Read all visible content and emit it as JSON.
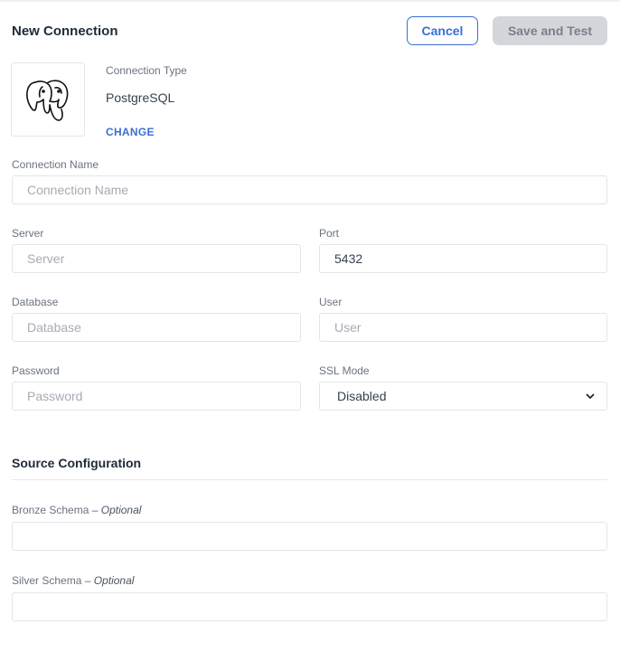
{
  "header": {
    "title": "New Connection",
    "cancel_label": "Cancel",
    "save_label": "Save and Test"
  },
  "connection_type": {
    "label": "Connection Type",
    "value": "PostgreSQL",
    "change_label": "CHANGE",
    "icon": "postgresql-elephant-icon"
  },
  "fields": {
    "connection_name": {
      "label": "Connection Name",
      "placeholder": "Connection Name",
      "value": ""
    },
    "server": {
      "label": "Server",
      "placeholder": "Server",
      "value": ""
    },
    "port": {
      "label": "Port",
      "placeholder": "",
      "value": "5432"
    },
    "database": {
      "label": "Database",
      "placeholder": "Database",
      "value": ""
    },
    "user": {
      "label": "User",
      "placeholder": "User",
      "value": ""
    },
    "password": {
      "label": "Password",
      "placeholder": "Password",
      "value": ""
    },
    "ssl_mode": {
      "label": "SSL Mode",
      "value": "Disabled"
    }
  },
  "source_configuration": {
    "title": "Source Configuration",
    "bronze_schema": {
      "label": "Bronze Schema",
      "optional": "– Optional",
      "value": ""
    },
    "silver_schema": {
      "label": "Silver Schema",
      "optional": "– Optional",
      "value": ""
    }
  },
  "colors": {
    "accent": "#3b6fd6",
    "disabled_button_bg": "#d4d6db",
    "border": "#e3e5e9"
  }
}
